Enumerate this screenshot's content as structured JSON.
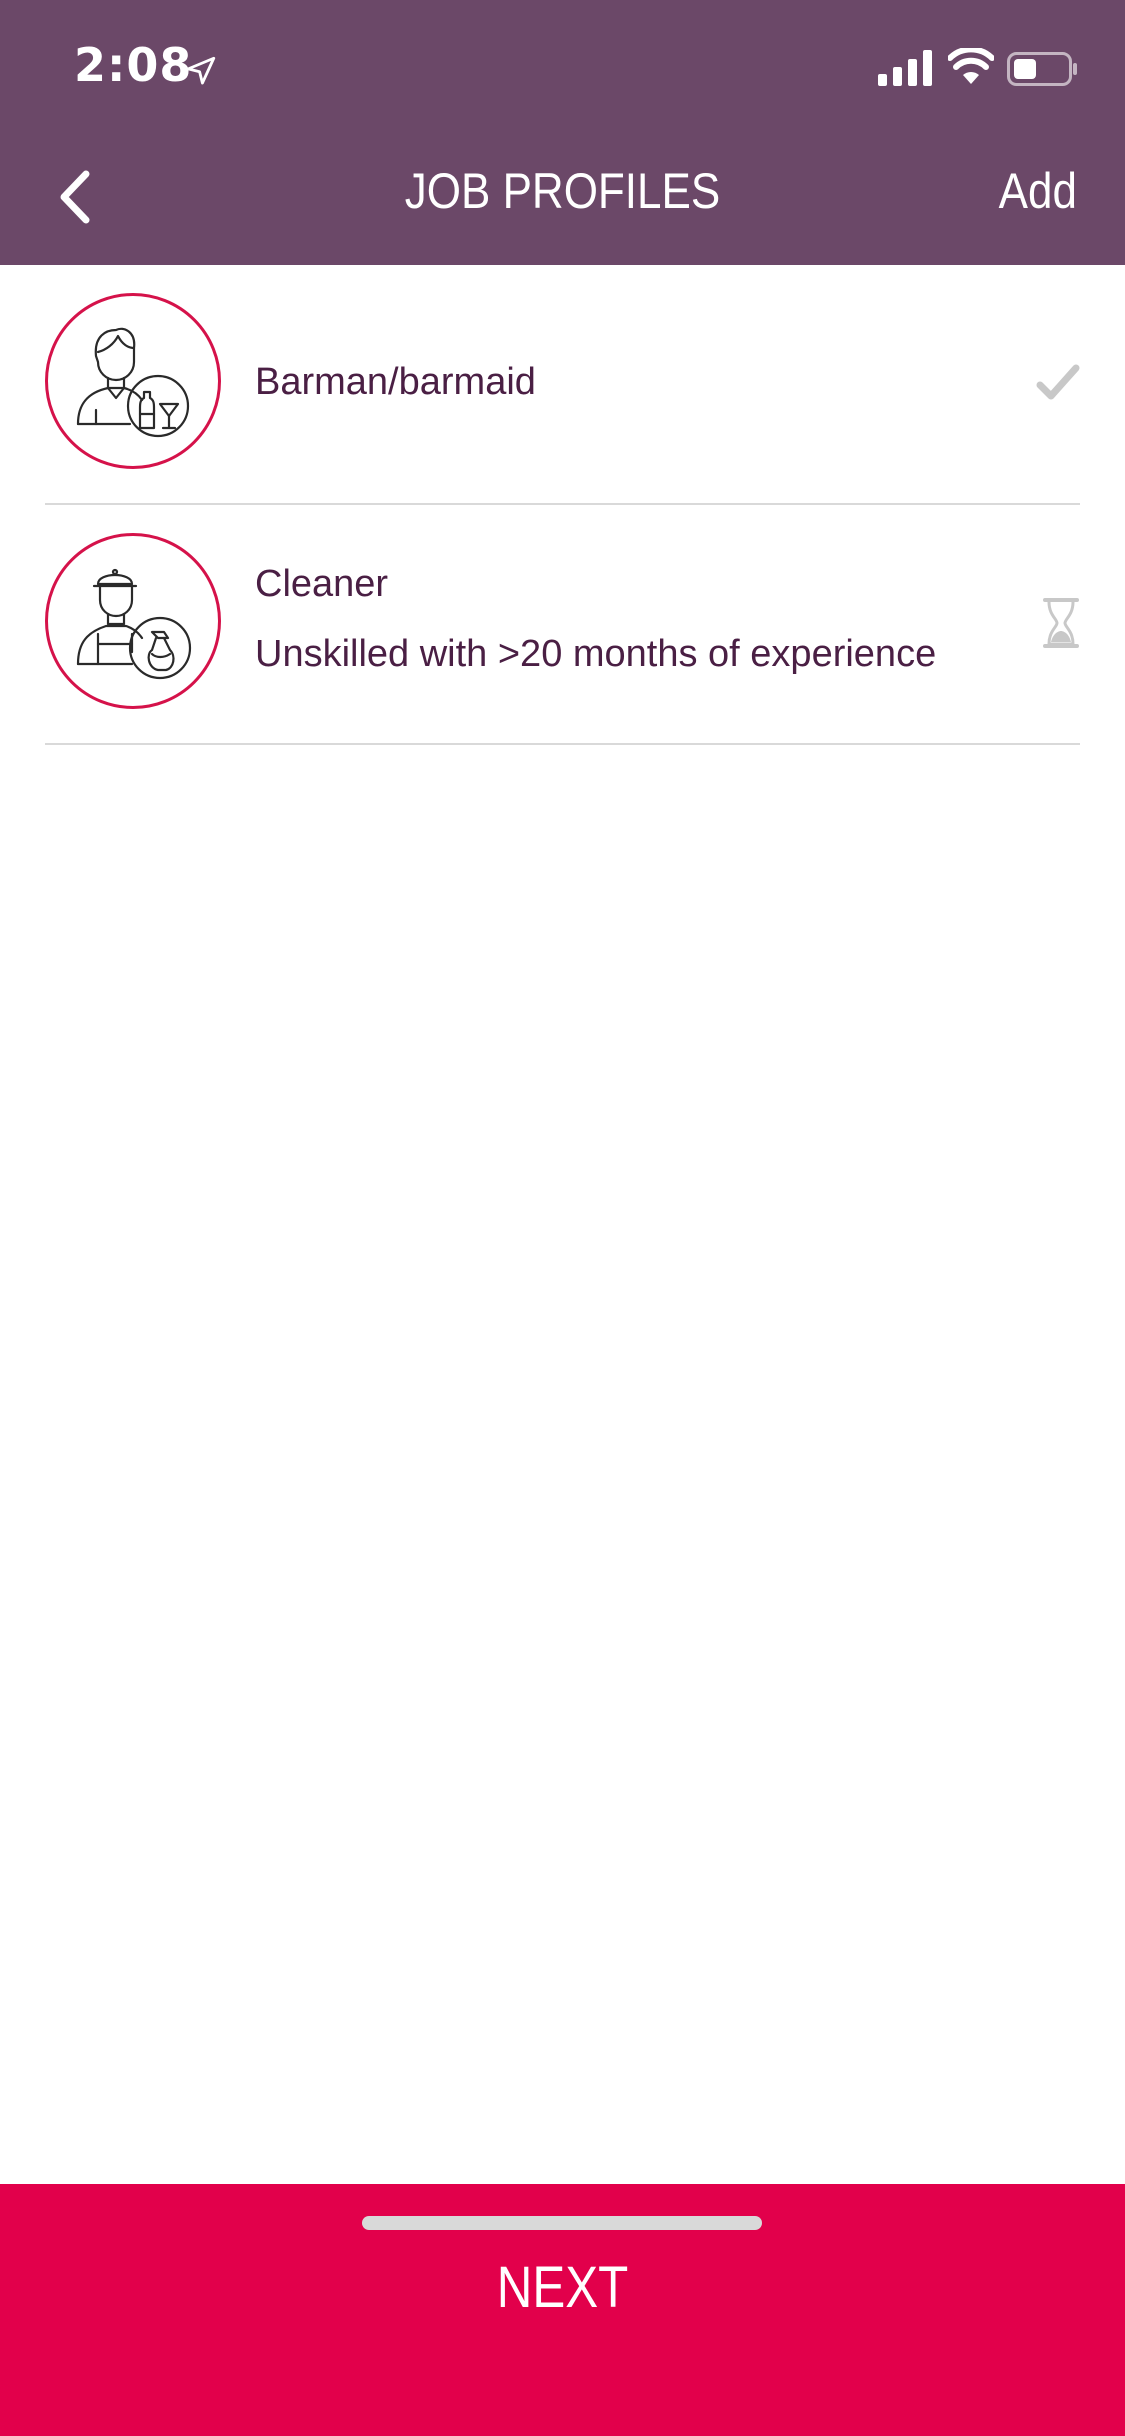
{
  "status_bar": {
    "time": "2:08"
  },
  "header": {
    "title": "JOB PROFILES",
    "add_label": "Add"
  },
  "profiles": [
    {
      "name": "Barman/barmaid",
      "detail": "",
      "status": "approved",
      "icon": "barman-icon"
    },
    {
      "name": "Cleaner",
      "detail": "Unskilled with >20 months of experience",
      "status": "pending",
      "icon": "cleaner-icon"
    }
  ],
  "footer": {
    "next_label": "NEXT"
  },
  "colors": {
    "header_bg": "#6b4868",
    "accent": "#e2004b",
    "text": "#4a1f44",
    "muted": "#cccccc"
  }
}
